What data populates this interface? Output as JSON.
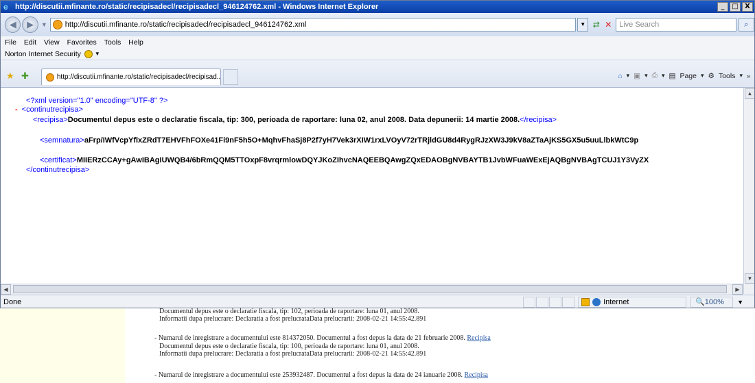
{
  "window": {
    "title": "http://discutii.mfinante.ro/static/recipisadecl/recipisadecl_946124762.xml - Windows Internet Explorer",
    "controls": [
      "_",
      "□",
      "X"
    ]
  },
  "address_bar": {
    "url": "http://discutii.mfinante.ro/static/recipisadecl/recipisadecl_946124762.xml",
    "search_placeholder": "Live Search"
  },
  "menu": [
    "File",
    "Edit",
    "View",
    "Favorites",
    "Tools",
    "Help"
  ],
  "norton_toolbar": {
    "label": "Norton Internet Security"
  },
  "tab": {
    "title": "http://discutii.mfinante.ro/static/recipisadecl/recipisad..."
  },
  "command_bar": {
    "page_label": "Page",
    "tools_label": "Tools"
  },
  "xml": {
    "declaration": "<?xml version=\"1.0\" encoding=\"UTF-8\" ?>",
    "collapse_symbol": "-",
    "root_open": "<continutrecipisa>",
    "root_close": "</continutrecipisa>",
    "recipisa_open": "<recipisa>",
    "recipisa_text": "Documentul depus este o declaratie fiscala, tip: 300, perioada de raportare: luna 02, anul 2008. Data depunerii: 14 martie 2008.",
    "recipisa_close": "</recipisa>",
    "semnatura_open": "<semnatura>",
    "semnatura_text": "aFrp/IWfVcpYflxZRdT7EHVFhFOXe41Fi9nF5h5O+MqhvFhaSj8P2f7yH7Vek3rXIW1rxLVOyV72rTRjldGU8d4RygRJzXW3J9kV8aZTaAjKS5GX5u5uuLlbkWtC9p",
    "certificat_open": "<certificat>",
    "certificat_text": "MIIERzCCAy+gAwIBAgIUWQB4/6bRmQQM5TTOxpF8vrqrmlowDQYJKoZIhvcNAQEEBQAwgZQxEDAOBgNVBAYTB1JvbWFuaWExEjAQBgNVBAgTCUJ1Y3VyZX"
  },
  "status": {
    "text": "Done",
    "zone": "Internet",
    "zoom": "100%"
  },
  "background_page": {
    "lines": [
      "Documentul depus este o declaratie fiscala, tip: 102, perioada de raportare: luna 01, anul 2008.",
      "Informatii dupa prelucrare: Declaratia a fost prelucrataData prelucrarii: 2008-02-21 14:55:42.891",
      "- Numarul de inregistrare a documentului este 814372050. Documentul a fost depus la data de 21 februarie 2008.",
      "Documentul depus este o declaratie fiscala, tip: 100, perioada de raportare: luna 01, anul 2008.",
      "Informatii dupa prelucrare: Declaratia a fost prelucrataData prelucrarii: 2008-02-21 14:55:42.891",
      "- Numarul de inregistrare a documentului este 253932487. Documentul a fost depus la data de 24 ianuarie 2008."
    ],
    "link": "Recipisa"
  }
}
